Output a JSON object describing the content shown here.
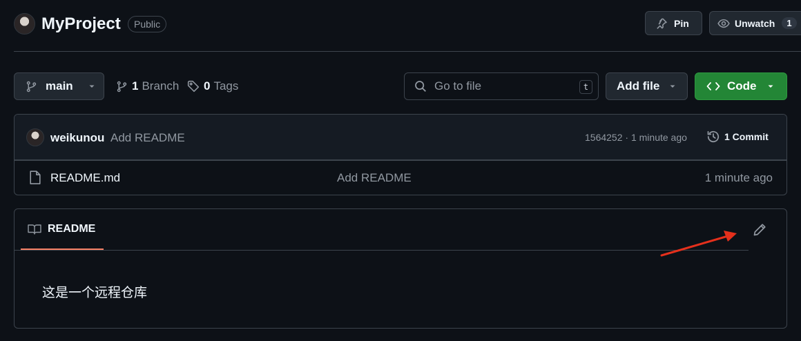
{
  "repo": {
    "name": "MyProject",
    "visibility": "Public",
    "pin_label": "Pin",
    "unwatch_label": "Unwatch",
    "watch_count": "1"
  },
  "toolbar": {
    "branch_name": "main",
    "branch_count": "1",
    "branch_label": "Branch",
    "tag_count": "0",
    "tag_label": "Tags",
    "search_placeholder": "Go to file",
    "search_shortcut": "t",
    "add_file_label": "Add file",
    "code_label": "Code"
  },
  "latest_commit": {
    "author": "weikunou",
    "message": "Add README",
    "hash": "1564252",
    "separator": "·",
    "time": "1 minute ago",
    "commit_count_label": "1 Commit"
  },
  "files": [
    {
      "name": "README.md",
      "message": "Add README",
      "time": "1 minute ago",
      "icon": "file-icon"
    }
  ],
  "readme": {
    "tab_label": "README",
    "content": "这是一个远程仓库"
  },
  "colors": {
    "background": "#0d1117",
    "code_button": "#238636",
    "active_tab_underline": "#f78166",
    "annotation_arrow": "#e5301c"
  }
}
